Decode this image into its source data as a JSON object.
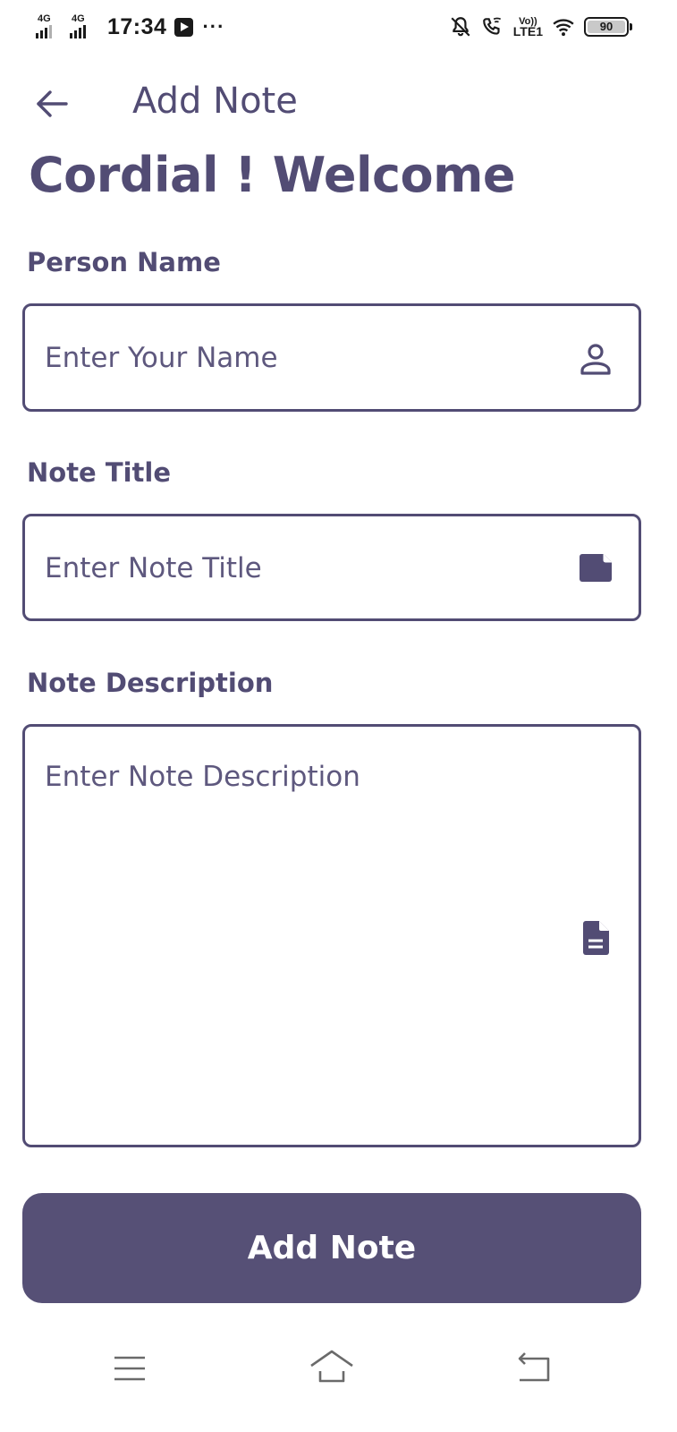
{
  "status_bar": {
    "sim1_network": "4G",
    "sim2_network": "4G",
    "time": "17:34",
    "more_indicator": "···",
    "volte_label_top": "Vo))",
    "volte_label_bottom": "LTE1",
    "battery_level": "90"
  },
  "app_bar": {
    "title": "Add Note",
    "back_icon": "arrow-left-icon"
  },
  "welcome_text": "Cordial ! Welcome",
  "form": {
    "person_name": {
      "label": "Person Name",
      "placeholder": "Enter Your Name",
      "value": "",
      "icon": "person-icon"
    },
    "note_title": {
      "label": "Note Title",
      "placeholder": "Enter Note Title",
      "value": "",
      "icon": "note-icon"
    },
    "note_description": {
      "label": "Note Description",
      "placeholder": "Enter Note Description",
      "value": "",
      "icon": "document-icon"
    },
    "submit_label": "Add Note"
  },
  "nav_bar": {
    "menu_icon": "menu-icon",
    "home_icon": "home-icon",
    "back_icon": "back-icon"
  },
  "colors": {
    "primary": "#524c74",
    "button_bg": "#565076",
    "background": "#ffffff"
  }
}
